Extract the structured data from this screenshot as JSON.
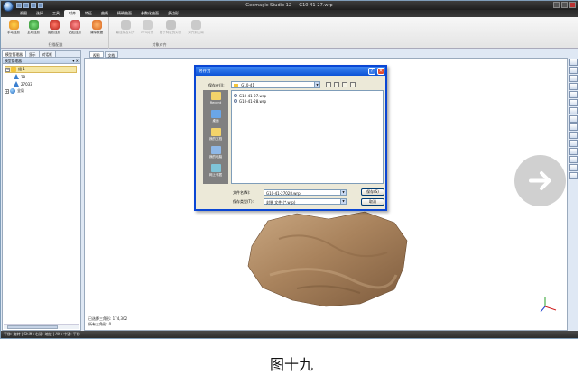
{
  "app": {
    "title": "Geomagic Studio 12 — G10-41-27.wrp",
    "menu_orb": "app-menu-orb"
  },
  "ribbon": {
    "tabs": [
      "视图",
      "选择",
      "工具",
      "对齐",
      "特征",
      "曲线",
      "精确曲面",
      "参数化曲面",
      "多边形"
    ],
    "active_tab": "对齐",
    "groups": [
      {
        "label": "扫描配准",
        "buttons": [
          "手动注册",
          "全局注册",
          "缩放注册",
          "粘贴注册",
          "清除数据"
        ]
      },
      {
        "label": "对象对齐",
        "buttons": [
          "最佳拟合对齐",
          "RPS对齐",
          "基于特征的对齐",
          "对齐到全局"
        ]
      }
    ]
  },
  "left_panel": {
    "tabs": [
      "模型管理器",
      "显示",
      "对话框"
    ],
    "header": "模型管理器",
    "pins": "▾ ✕",
    "tree": [
      {
        "label": "组 1",
        "expander": "−",
        "level": 0,
        "selected": true
      },
      {
        "label": "28",
        "level": 1
      },
      {
        "label": "27033",
        "level": 1
      },
      {
        "label": "全局",
        "expander": "+",
        "level": 0
      }
    ]
  },
  "viewport": {
    "tabs": [
      "视图",
      "文档"
    ],
    "stats": [
      "已选择三角形: 174,302",
      "所有三角形: 0"
    ]
  },
  "status_bar": "平移: 旋转 | Shift+右键: 缩放 | Alt+中键: 平移",
  "dialog": {
    "title": "另存为",
    "help": "?",
    "close": "✕",
    "save_in_label": "保存在(I):",
    "save_in_value": "G10-41",
    "places": [
      "Recent",
      "桌面",
      "我的文档",
      "我的电脑",
      "网上邻居"
    ],
    "files": [
      "G10-41-27.wrp",
      "G10-41-28.wrp"
    ],
    "filename_label": "文件名(N):",
    "filename_value": "G10-41-27028.wrp",
    "filetype_label": "保存类型(T):",
    "filetype_value": "封装 文件 (*.wrp)",
    "save_button": "保存(S)",
    "cancel_button": "取消"
  },
  "colors": {
    "dialog_border": "#0a46d4",
    "rock_base": "#b08c66",
    "nav_circle": "#c8c8c8"
  },
  "caption": "图十九"
}
